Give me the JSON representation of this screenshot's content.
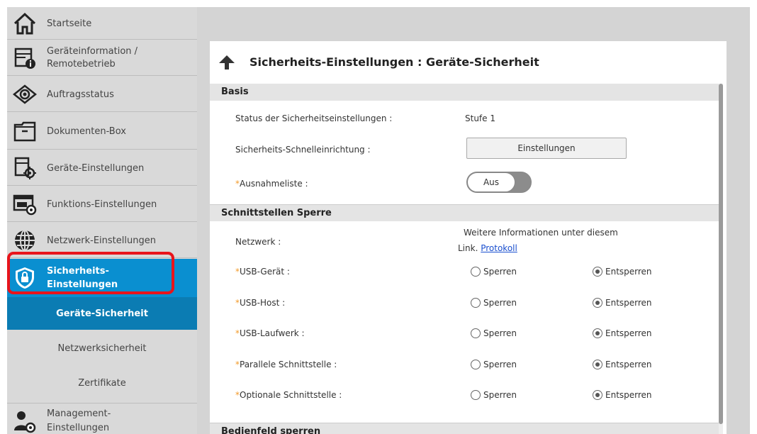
{
  "sidebar": {
    "items": [
      {
        "label": "Startseite",
        "icon": "home-icon"
      },
      {
        "label": "Geräteinformation /",
        "label2": "Remotebetrieb",
        "icon": "device-info-icon"
      },
      {
        "label": "Auftragsstatus",
        "icon": "eye-icon"
      },
      {
        "label": "Dokumenten-Box",
        "icon": "box-icon"
      },
      {
        "label": "Geräte-Einstellungen",
        "icon": "device-settings-icon"
      },
      {
        "label": "Funktions-Einstellungen",
        "icon": "function-settings-icon"
      },
      {
        "label": "Netzwerk-Einstellungen",
        "icon": "globe-icon"
      },
      {
        "label": "Sicherheits-",
        "label2": "Einstellungen",
        "icon": "shield-lock-icon"
      },
      {
        "label": "Management-",
        "label2": "Einstellungen",
        "icon": "management-icon"
      }
    ],
    "sub_items": [
      {
        "label": "Geräte-Sicherheit"
      },
      {
        "label": "Netzwerksicherheit"
      },
      {
        "label": "Zertifikate"
      }
    ]
  },
  "main": {
    "title": "Sicherheits-Einstellungen : Geräte-Sicherheit",
    "sections": {
      "basis": "Basis",
      "schnittstellen": "Schnittstellen Sperre",
      "bedienfeld": "Bedienfeld sperren"
    },
    "basis": {
      "status_label": "Status der Sicherheitseinstellungen :",
      "status_value": "Stufe 1",
      "schnell_label": "Sicherheits-Schnelleinrichtung :",
      "schnell_button": "Einstellungen",
      "ausnahme_label": "Ausnahmeliste :",
      "ausnahme_toggle": "Aus"
    },
    "schnittstellen": {
      "netzwerk_label": "Netzwerk :",
      "netzwerk_info": "Weitere Informationen unter diesem",
      "netzwerk_link_prefix": "Link.",
      "netzwerk_link": "Protokoll",
      "rows": [
        {
          "label": "USB-Gerät :",
          "opt1": "Sperren",
          "opt2": "Entsperren"
        },
        {
          "label": "USB-Host :",
          "opt1": "Sperren",
          "opt2": "Entsperren"
        },
        {
          "label": "USB-Laufwerk :",
          "opt1": "Sperren",
          "opt2": "Entsperren"
        },
        {
          "label": "Parallele Schnittstelle :",
          "opt1": "Sperren",
          "opt2": "Entsperren"
        },
        {
          "label": "Optionale Schnittstelle :",
          "opt1": "Sperren",
          "opt2": "Entsperren"
        }
      ]
    },
    "required_marker": "*"
  },
  "colors": {
    "active_nav": "#0a8fd0",
    "active_sub": "#0b7cb3",
    "highlight": "#e8141b",
    "required": "#f39a2b",
    "link": "#1a4fcf"
  }
}
